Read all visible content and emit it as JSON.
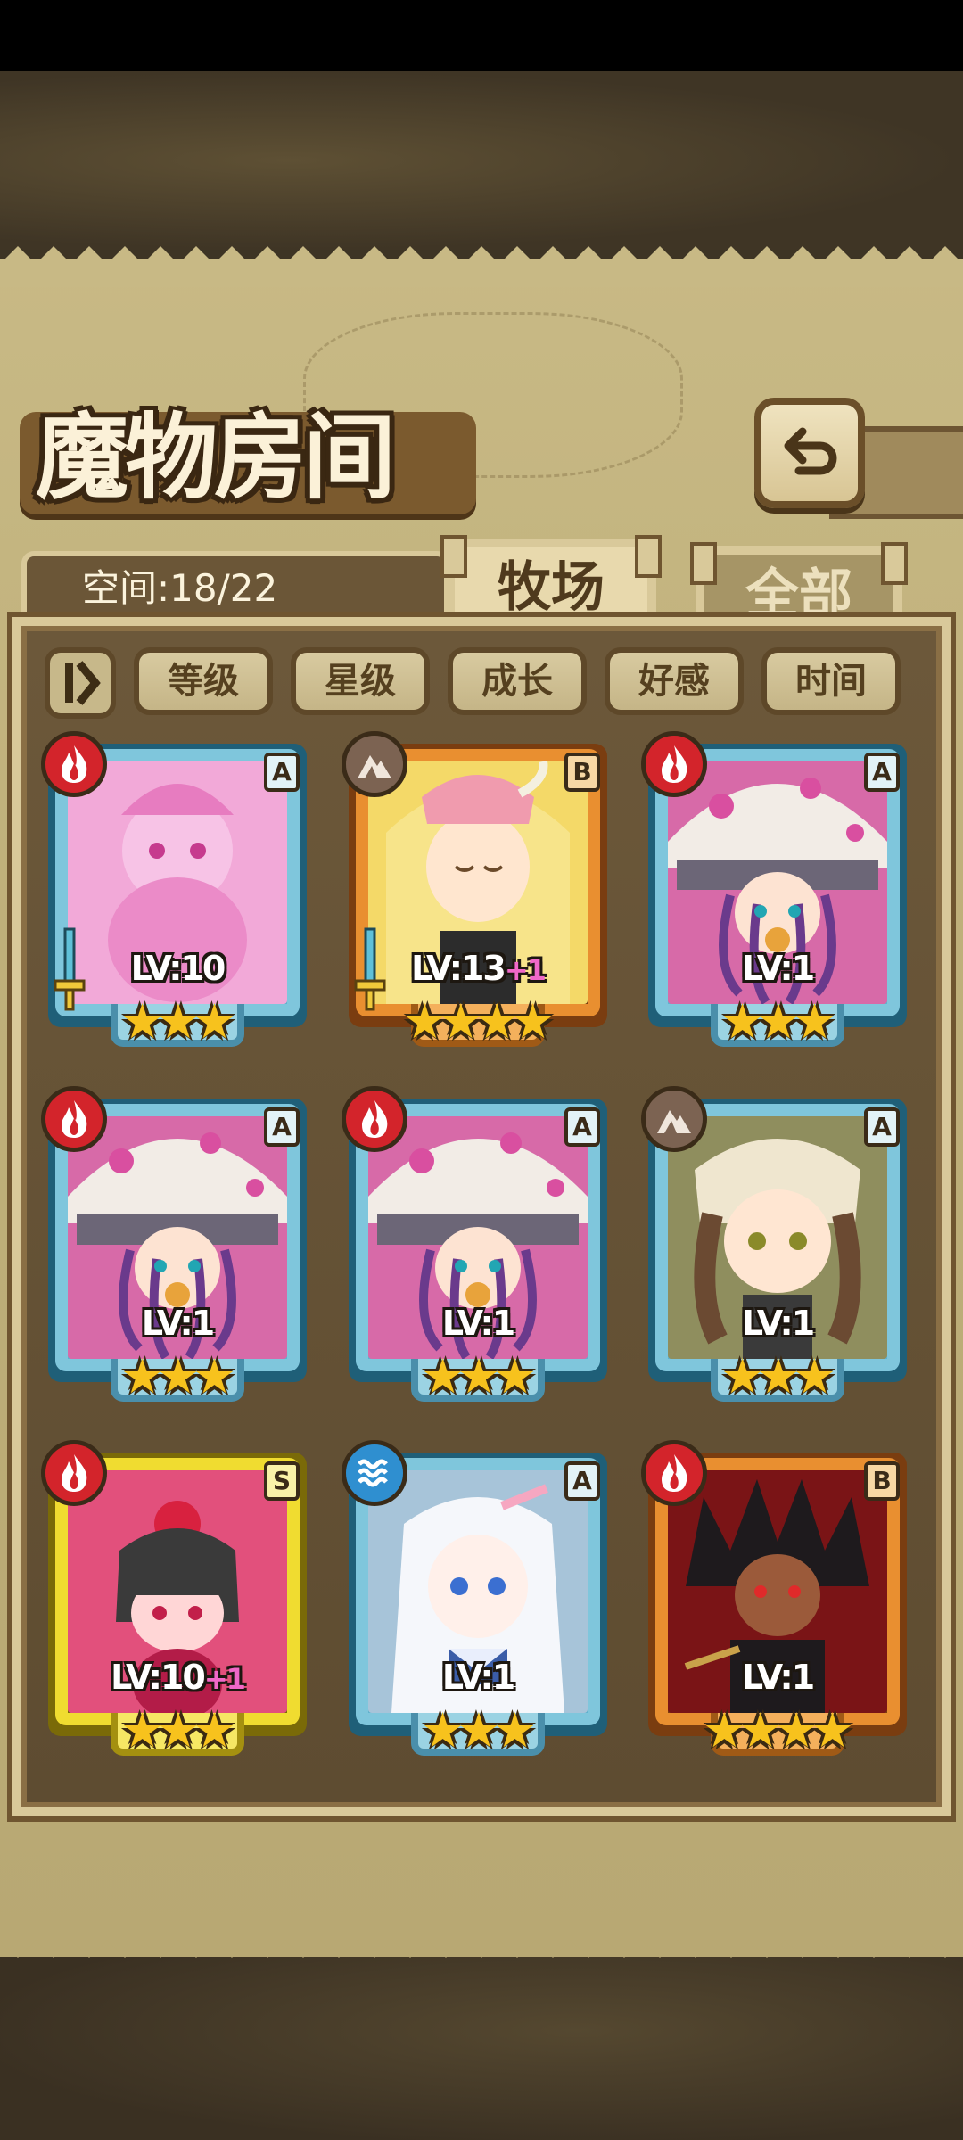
{
  "header": {
    "title": "魔物房间"
  },
  "capacity": {
    "label": "空间:18/22"
  },
  "tabs": [
    {
      "label": "牧场",
      "active": true
    },
    {
      "label": "全部",
      "active": false
    }
  ],
  "filters": [
    {
      "label": "等级"
    },
    {
      "label": "星级"
    },
    {
      "label": "成长"
    },
    {
      "label": "好感"
    },
    {
      "label": "时间"
    }
  ],
  "cards": [
    {
      "level": "LV:10",
      "bonus": "",
      "stars": "★★★",
      "element": "fire",
      "rank": "A",
      "frame": "blue",
      "equipped": true,
      "art": "pink-slime-girl"
    },
    {
      "level": "LV:13",
      "bonus": "+1",
      "stars": "★★★★",
      "element": "earth",
      "rank": "B",
      "frame": "orange",
      "equipped": true,
      "art": "blonde-horned-girl"
    },
    {
      "level": "LV:1",
      "bonus": "",
      "stars": "★★★",
      "element": "fire",
      "rank": "A",
      "frame": "blue",
      "equipped": false,
      "art": "mushroom-tentacle-girl"
    },
    {
      "level": "LV:1",
      "bonus": "",
      "stars": "★★★",
      "element": "fire",
      "rank": "A",
      "frame": "blue",
      "equipped": false,
      "art": "mushroom-tentacle-girl"
    },
    {
      "level": "LV:1",
      "bonus": "",
      "stars": "★★★",
      "element": "fire",
      "rank": "A",
      "frame": "blue",
      "equipped": false,
      "art": "mushroom-tentacle-girl"
    },
    {
      "level": "LV:1",
      "bonus": "",
      "stars": "★★★",
      "element": "earth",
      "rank": "A",
      "frame": "blue",
      "equipped": false,
      "art": "owl-hood-girl"
    },
    {
      "level": "LV:10",
      "bonus": "+1",
      "stars": "★★★",
      "element": "fire",
      "rank": "S",
      "frame": "gold",
      "equipped": false,
      "art": "flower-bob-girl"
    },
    {
      "level": "LV:1",
      "bonus": "",
      "stars": "★★★",
      "element": "water",
      "rank": "A",
      "frame": "blue",
      "equipped": false,
      "art": "white-bunny-girl"
    },
    {
      "level": "LV:1",
      "bonus": "",
      "stars": "★★★★",
      "element": "fire",
      "rank": "B",
      "frame": "orange",
      "equipped": false,
      "art": "dark-spiky-girl"
    }
  ],
  "colors": {
    "fire": "#d3242b",
    "earth": "#7c6352",
    "water": "#2f8fd0",
    "frame_blue": "#7fc6dc",
    "frame_orange": "#e98f30",
    "frame_gold": "#f0dc30",
    "star": "#f7c21d",
    "bonus": "#f068c8"
  }
}
